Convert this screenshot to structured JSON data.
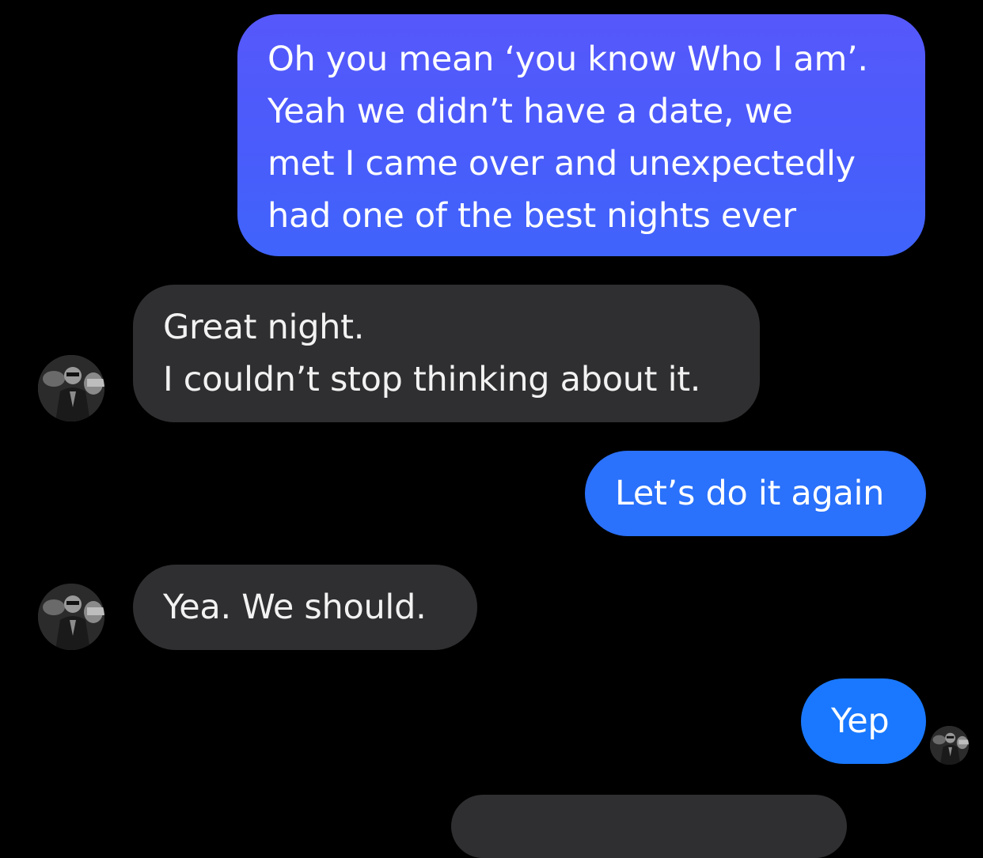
{
  "conversation": {
    "messages": [
      {
        "sender": "me",
        "lines": [
          "Oh you mean ‘you know Who I am’.",
          "Yeah we didn’t have a date, we",
          "met I came over and unexpectedly",
          "had one of the best nights ever"
        ]
      },
      {
        "sender": "them",
        "lines": [
          "Great night.",
          "I couldn’t stop thinking about it."
        ]
      },
      {
        "sender": "me",
        "lines": [
          "Let’s do it again"
        ]
      },
      {
        "sender": "them",
        "lines": [
          "Yea. We should."
        ]
      },
      {
        "sender": "me",
        "lines": [
          "Yep"
        ]
      }
    ]
  },
  "icons": {
    "contact_avatar": "contact-avatar-photo",
    "read_receipt": "read-receipt-avatar"
  },
  "colors": {
    "background": "#000000",
    "sent_bubble": "#1f7bff",
    "sent_bubble_gradient_top": "#5658fb",
    "received_bubble": "#2f2f31",
    "text": "#ffffff"
  }
}
